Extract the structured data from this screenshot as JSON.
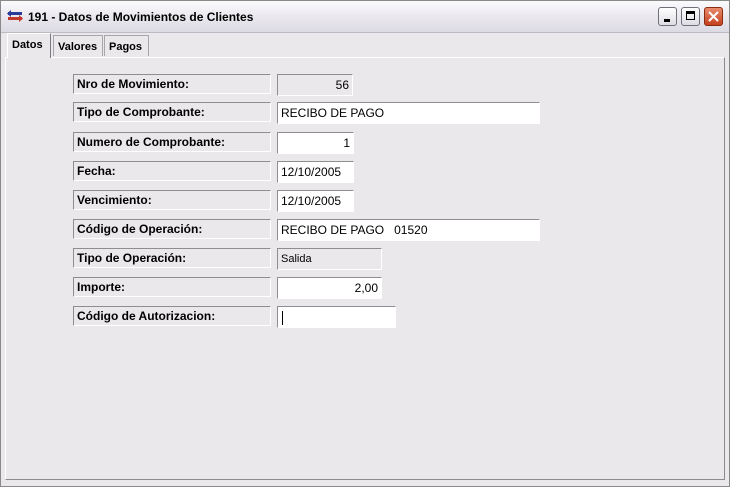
{
  "window": {
    "title": "191 - Datos de Movimientos de Clientes"
  },
  "tabs": [
    {
      "label": "Datos"
    },
    {
      "label": "Valores"
    },
    {
      "label": "Pagos"
    }
  ],
  "form": {
    "nro_movimiento": {
      "label": "Nro de Movimiento:",
      "value": "56"
    },
    "tipo_comprobante": {
      "label": "Tipo de Comprobante:",
      "value": "RECIBO DE PAGO"
    },
    "numero_comprobante": {
      "label": "Numero de Comprobante:",
      "value": "1"
    },
    "fecha": {
      "label": "Fecha:",
      "value": "12/10/2005"
    },
    "vencimiento": {
      "label": "Vencimiento:",
      "value": "12/10/2005"
    },
    "codigo_operacion": {
      "label": "Código de Operación:",
      "value": "RECIBO DE PAGO   01520"
    },
    "tipo_operacion": {
      "label": "Tipo de Operación:",
      "value": "Salida"
    },
    "importe": {
      "label": "Importe:",
      "value": "2,00"
    },
    "codigo_autorizacion": {
      "label": "Código de Autorizacion:",
      "value": ""
    }
  }
}
